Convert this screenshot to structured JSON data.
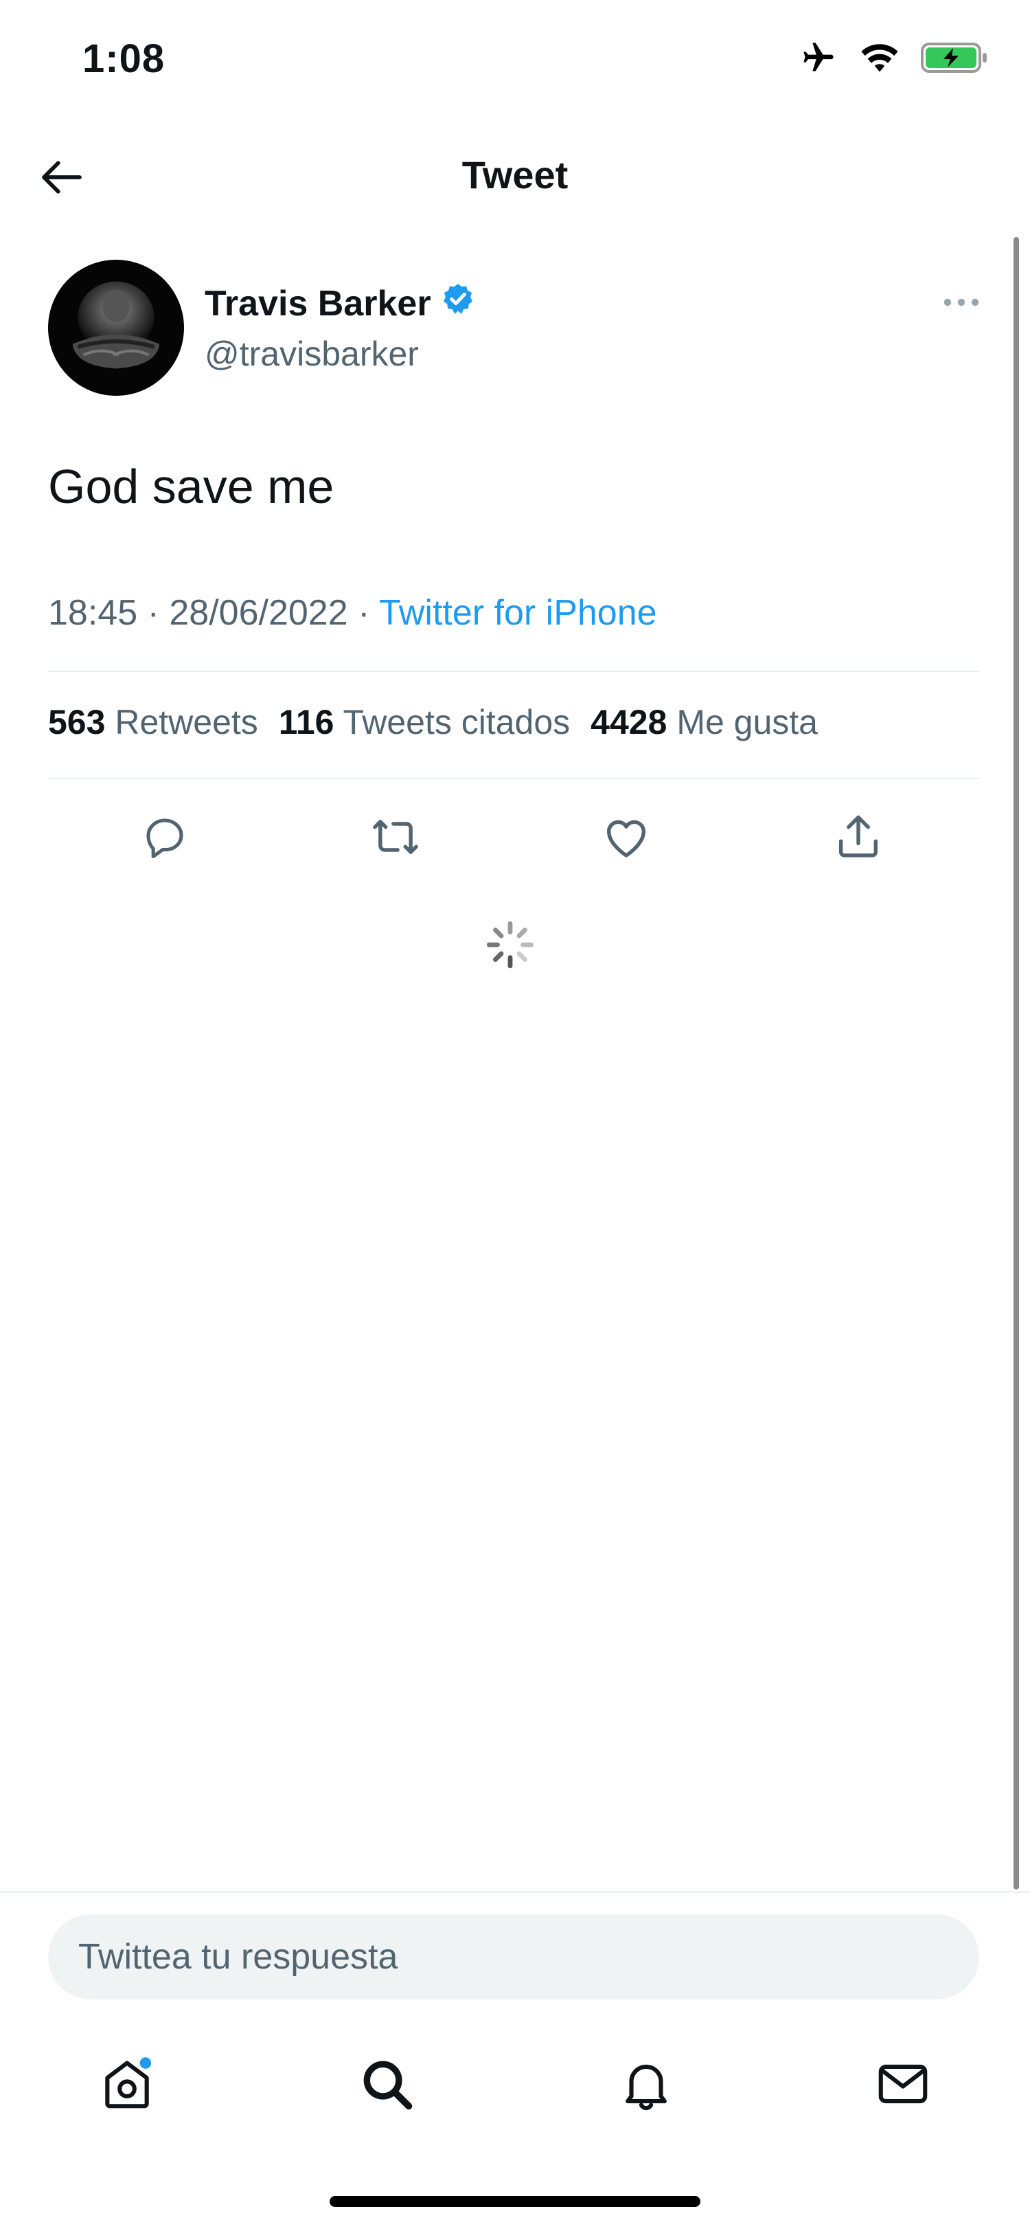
{
  "status_bar": {
    "time": "1:08",
    "icons": [
      "airplane-icon",
      "wifi-icon",
      "battery-charging-icon"
    ]
  },
  "header": {
    "back_icon": "arrow-left-icon",
    "title": "Tweet"
  },
  "tweet": {
    "author": {
      "name": "Travis Barker",
      "verified": true,
      "handle": "@travisbarker"
    },
    "text": "God save me",
    "time": "18:45",
    "separator": "·",
    "date": "28/06/2022",
    "source": "Twitter for iPhone",
    "stats": {
      "retweets_count": "563",
      "retweets_label": "Retweets",
      "quotes_count": "116",
      "quotes_label": "Tweets citados",
      "likes_count": "4428",
      "likes_label": "Me gusta"
    },
    "actions": [
      "reply-icon",
      "retweet-icon",
      "like-icon",
      "share-icon"
    ]
  },
  "reply": {
    "placeholder": "Twittea tu respuesta"
  },
  "tab_bar": {
    "items": [
      "home-icon",
      "search-icon",
      "notifications-icon",
      "messages-icon"
    ],
    "home_has_notification_dot": true
  },
  "colors": {
    "accent": "#1d9bf0",
    "secondary_text": "#536471",
    "primary_text": "#0f1419",
    "battery_fill": "#34c759"
  }
}
